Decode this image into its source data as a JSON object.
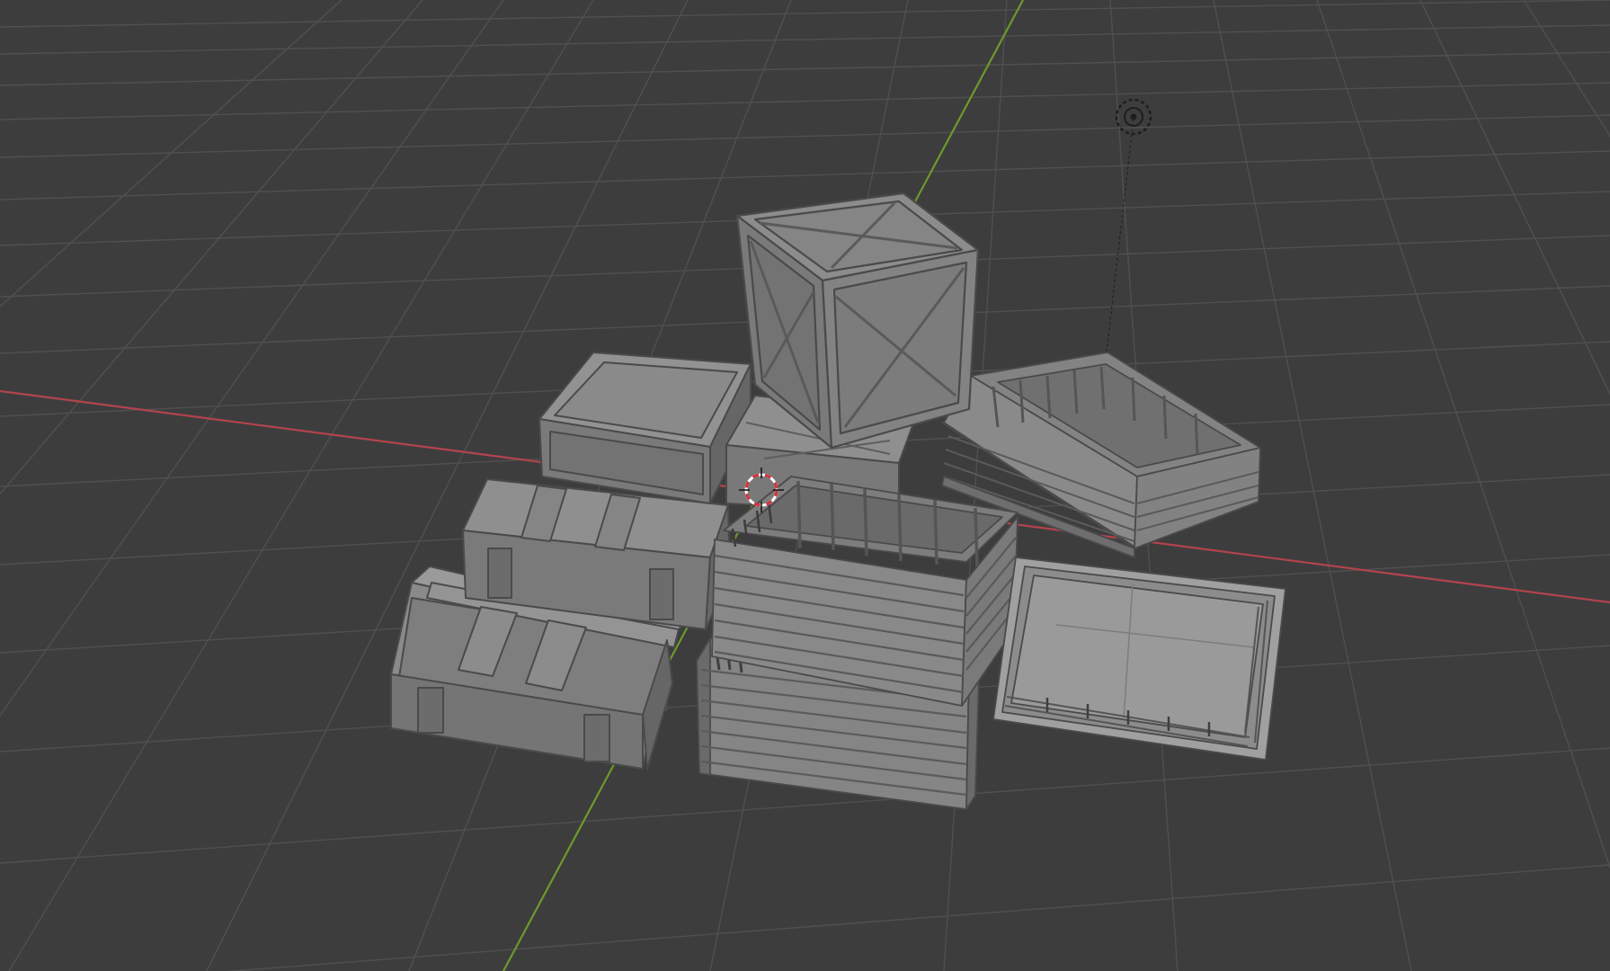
{
  "viewport": {
    "view": "3d-viewport",
    "shading": "solid",
    "colors": {
      "background": "#3d3d3d",
      "grid_line": "#4f4f4f",
      "x_axis": "#b4434d",
      "y_axis": "#6c9a2b",
      "mesh_light": "#8e8e8e",
      "mesh_mid": "#7c7c7c",
      "mesh_dark": "#666666",
      "mesh_edge": "#4e4e4e"
    }
  },
  "scene": {
    "objects": [
      {
        "name": "crate-x-brace",
        "kind": "wooden-crate"
      },
      {
        "name": "crate-closed-left",
        "kind": "wooden-crate"
      },
      {
        "name": "crate-small-middle",
        "kind": "wooden-crate"
      },
      {
        "name": "crate-open-slatted-right",
        "kind": "slatted-crate"
      },
      {
        "name": "crate-open-slatted-front",
        "kind": "slatted-crate"
      },
      {
        "name": "crate-open-slatted-bottom",
        "kind": "slatted-crate"
      },
      {
        "name": "crate-long-upper",
        "kind": "ammo-box"
      },
      {
        "name": "crate-long-lower",
        "kind": "ammo-box"
      },
      {
        "name": "crate-lid-tray",
        "kind": "tray"
      }
    ],
    "light": {
      "icon": "sun-lamp-icon"
    },
    "cursor": {
      "icon": "3d-cursor-icon"
    }
  }
}
